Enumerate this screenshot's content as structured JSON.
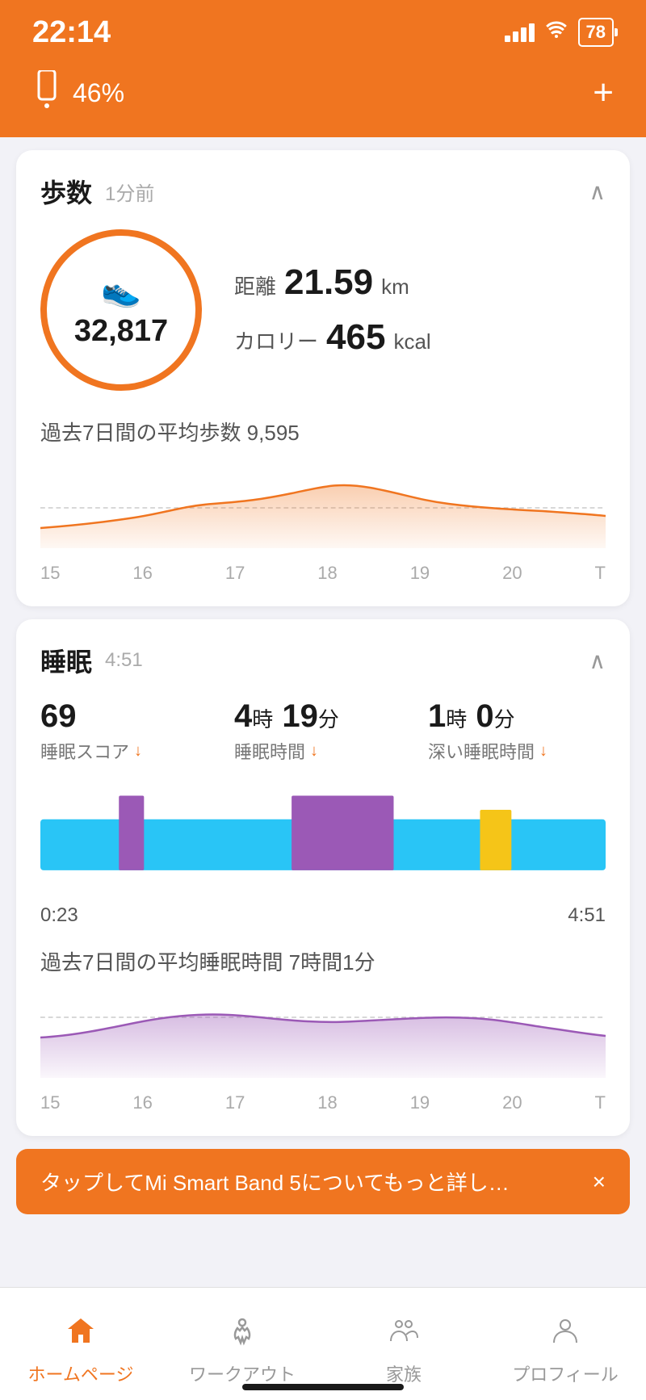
{
  "statusBar": {
    "time": "22:14",
    "battery": "78"
  },
  "header": {
    "devicePercent": "46%",
    "addLabel": "+"
  },
  "stepsCard": {
    "title": "歩数",
    "subtitle": "1分前",
    "stepsCount": "32,817",
    "distanceLabel": "距離",
    "distanceValue": "21.59",
    "distanceUnit": "km",
    "calorieLabel": "カロリー",
    "calorieValue": "465",
    "calorieUnit": "kcal",
    "avgLabel": "過去7日間の平均歩数 9,595",
    "chartLabels": [
      "15",
      "16",
      "17",
      "18",
      "19",
      "20",
      "T"
    ]
  },
  "sleepCard": {
    "title": "睡眠",
    "subtitle": "4:51",
    "scoreValue": "69",
    "scoreLabel": "睡眠スコア",
    "sleepTimeValue": "4",
    "sleepTimeUnit1": "時",
    "sleepTimeMin": "19",
    "sleepTimeUnit2": "分",
    "sleepTimeLabel": "睡眠時間",
    "deepValue": "1",
    "deepUnit1": "時",
    "deepMin": "0",
    "deepUnit2": "分",
    "deepLabel": "深い睡眠時間",
    "startTime": "0:23",
    "endTime": "4:51",
    "avgLabel": "過去7日間の平均睡眠時間 7時間1分",
    "chartLabels": [
      "15",
      "16",
      "17",
      "18",
      "19",
      "20",
      "T"
    ]
  },
  "toast": {
    "text": "タップしてMi Smart Band 5についてもっと詳し…",
    "closeLabel": "×"
  },
  "bottomNav": {
    "items": [
      {
        "label": "ホームページ",
        "icon": "🏠",
        "active": true
      },
      {
        "label": "ワークアウト",
        "icon": "🏃",
        "active": false
      },
      {
        "label": "家族",
        "icon": "👥",
        "active": false
      },
      {
        "label": "プロフィール",
        "icon": "👤",
        "active": false
      }
    ]
  }
}
